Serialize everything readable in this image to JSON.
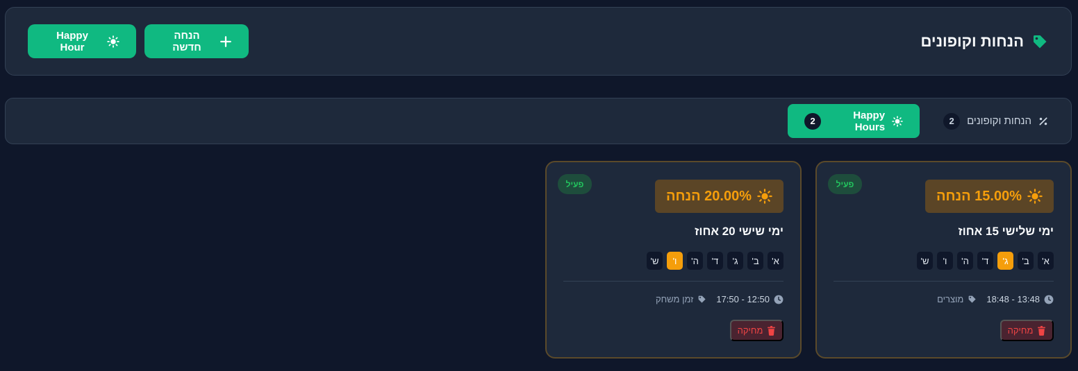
{
  "header": {
    "title": "הנחות וקופונים",
    "new_discount_label": "הנחה חדשה",
    "happy_hour_label": "Happy Hour"
  },
  "tabs": [
    {
      "label": "הנחות וקופונים",
      "count": "2",
      "icon": "percent-icon",
      "active": false
    },
    {
      "label": "Happy Hours",
      "count": "2",
      "icon": "sun-icon",
      "active": true
    }
  ],
  "cards": [
    {
      "status": "פעיל",
      "discount_label": "15.00% הנחה",
      "name": "ימי שלישי 15 אחוז",
      "days": [
        "א'",
        "ב'",
        "ג'",
        "ד'",
        "ה'",
        "ו'",
        "ש'"
      ],
      "active_days": [
        "ג'"
      ],
      "time_range": "13:48 - 18:48",
      "applies_to": "מוצרים",
      "delete_label": "מחיקה"
    },
    {
      "status": "פעיל",
      "discount_label": "20.00% הנחה",
      "name": "ימי שישי 20 אחוז",
      "days": [
        "א'",
        "ב'",
        "ג'",
        "ד'",
        "ה'",
        "ו'",
        "ש'"
      ],
      "active_days": [
        "ו'"
      ],
      "time_range": "12:50 - 17:50",
      "applies_to": "זמן משחק",
      "delete_label": "מחיקה"
    }
  ],
  "colors": {
    "accent": "#10b981",
    "warning": "#f59e0b",
    "danger": "#ef4444",
    "background": "#0f172a",
    "panel": "#1e293b"
  }
}
